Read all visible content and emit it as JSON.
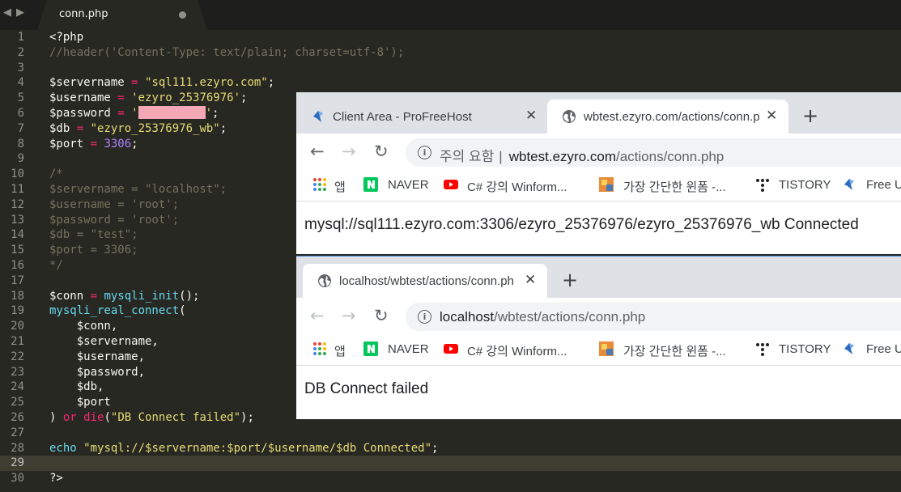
{
  "editor": {
    "nav_back": "◀",
    "nav_forward": "▶",
    "tab_title": "conn.php",
    "current_line": 29,
    "line_numbers": [
      "1",
      "2",
      "3",
      "4",
      "5",
      "6",
      "7",
      "8",
      "9",
      "10",
      "11",
      "12",
      "13",
      "14",
      "15",
      "16",
      "17",
      "18",
      "19",
      "20",
      "21",
      "22",
      "23",
      "24",
      "25",
      "26",
      "27",
      "28",
      "29",
      "30"
    ],
    "code": {
      "l1": "<?php",
      "l2": "//header('Content-Type: text/plain; charset=utf-8');",
      "l4_var": "$servername",
      "l4_op": " = ",
      "l4_val": "\"sql111.ezyro.com\"",
      "l4_end": ";",
      "l5_var": "$username",
      "l5_op": " = ",
      "l5_val": "'ezyro_25376976'",
      "l5_end": ";",
      "l6_var": "$password",
      "l6_op": " = ",
      "l6_q1": "'",
      "l6_q2": "'",
      "l6_end": ";",
      "l7_var": "$db",
      "l7_op": " = ",
      "l7_val": "\"ezyro_25376976_wb\"",
      "l7_end": ";",
      "l8_var": "$port",
      "l8_op": " = ",
      "l8_val": "3306",
      "l8_end": ";",
      "l10": "/*",
      "l11": "$servername = \"localhost\";",
      "l12": "$username = 'root';",
      "l13": "$password = 'root';",
      "l14": "$db = \"test\";",
      "l15": "$port = 3306;",
      "l16": "*/",
      "l18_var": "$conn",
      "l18_op": " = ",
      "l18_fn": "mysqli_init",
      "l18_end": "();",
      "l19_fn": "mysqli_real_connect",
      "l19_end": "(",
      "l20": "    $conn,",
      "l21": "    $servername,",
      "l22": "    $username,",
      "l23": "    $password,",
      "l24": "    $db,",
      "l25": "    $port",
      "l26_a": ") ",
      "l26_or": "or",
      "l26_sp": " ",
      "l26_die": "die",
      "l26_p1": "(",
      "l26_str": "\"DB Connect failed\"",
      "l26_p2": ");",
      "l28_echo": "echo",
      "l28_sp": " ",
      "l28_str": "\"mysql://$servername:$port/$username/$db Connected\"",
      "l28_end": ";",
      "l30": "?>"
    }
  },
  "browser1": {
    "tab1_title": "Client Area - ProFreeHost",
    "tab1_close": "✕",
    "tab2_title": "wbtest.ezyro.com/actions/conn.p",
    "tab2_close": "✕",
    "new_tab": "+",
    "back": "←",
    "forward": "→",
    "reload": "↻",
    "info": "i",
    "security_label": "주의 요함",
    "separator": "|",
    "url_host": "wbtest.ezyro.com",
    "url_path": "/actions/conn.php",
    "bookmarks": [
      "앱",
      "NAVER",
      "C# 강의 Winform...",
      "가장 간단한 윈폼 -...",
      "TISTORY",
      "Free U"
    ],
    "content": "mysql://sql111.ezyro.com:3306/ezyro_25376976/ezyro_25376976_wb Connected"
  },
  "browser2": {
    "tab1_title": "localhost/wbtest/actions/conn.ph",
    "tab1_close": "✕",
    "new_tab": "+",
    "back": "←",
    "forward": "→",
    "reload": "↻",
    "info": "i",
    "url_host": "localhost",
    "url_path": "/wbtest/actions/conn.php",
    "bookmarks": [
      "앱",
      "NAVER",
      "C# 강의 Winform...",
      "가장 간단한 윈폼 -...",
      "TISTORY",
      "Free U"
    ],
    "content": "DB Connect failed"
  },
  "colors": {
    "editor_bg": "#272822",
    "keyword": "#f92672",
    "string": "#e6db74",
    "number": "#ae81ff",
    "comment": "#75715e",
    "function": "#66d9ef",
    "password_redaction": "#f4a8b5",
    "naver_green": "#03c75a",
    "youtube_red": "#ff0000"
  }
}
